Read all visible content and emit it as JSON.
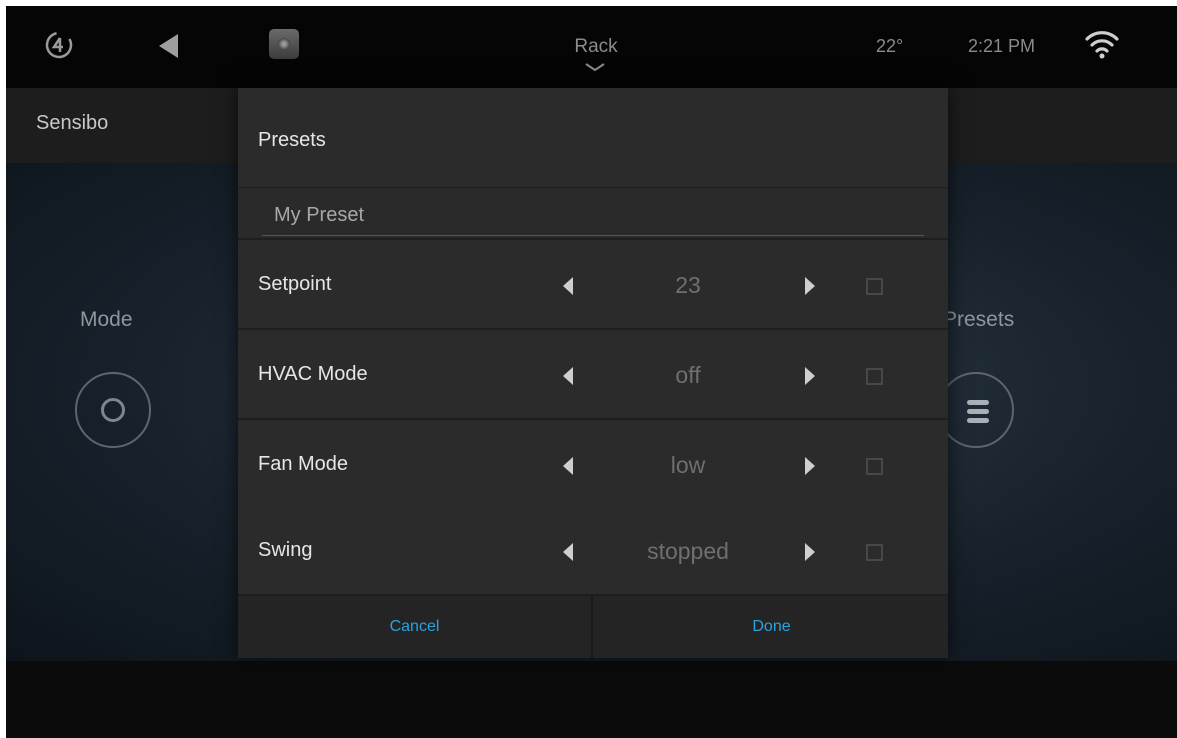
{
  "topbar": {
    "logo_icon": "control4-logo-icon",
    "back_icon": "back-arrow-icon",
    "room_icon": "speaker-icon",
    "room_name": "Rack",
    "temperature": "22°",
    "time": "2:21 PM",
    "wifi_icon": "wifi-icon"
  },
  "app": {
    "title": "Sensibo",
    "mode_label": "Mode",
    "presets_label": "Presets"
  },
  "dialog": {
    "title": "Presets",
    "name_placeholder": "My Preset",
    "rows": [
      {
        "label": "Setpoint",
        "value": "23",
        "checked": false
      },
      {
        "label": "HVAC Mode",
        "value": "off",
        "checked": false
      },
      {
        "label": "Fan Mode",
        "value": "low",
        "checked": false
      },
      {
        "label": "Swing",
        "value": "stopped",
        "checked": false
      }
    ],
    "cancel_label": "Cancel",
    "done_label": "Done"
  },
  "colors": {
    "accent": "#29a3e0",
    "dialog_bg": "#2b2b2b",
    "value_text": "#6f6f6f"
  }
}
